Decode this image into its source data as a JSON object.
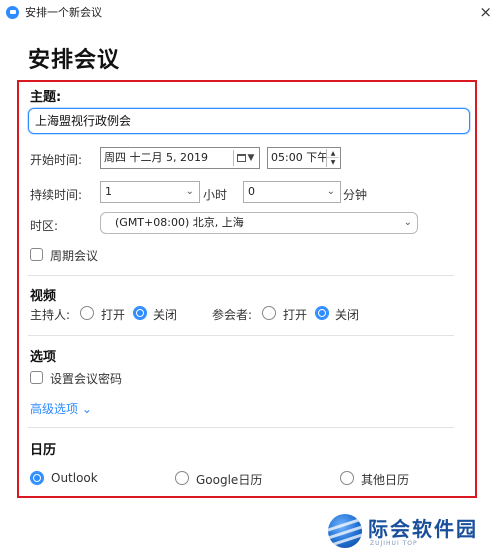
{
  "window": {
    "title": "安排一个新会议",
    "close_glyph": "×"
  },
  "page_title": "安排会议",
  "topic": {
    "label": "主题:",
    "value": "上海盟视行政例会"
  },
  "start_time": {
    "label": "开始时间:",
    "date_value": "周四  十二月   5, 2019",
    "time_value": "05:00 下午"
  },
  "duration": {
    "label": "持续时间:",
    "hours_value": "1",
    "hours_unit": "小时",
    "minutes_value": "0",
    "minutes_unit": "分钟"
  },
  "timezone": {
    "label": "时区:",
    "value": "(GMT+08:00) 北京, 上海"
  },
  "recurring": {
    "label": "周期会议",
    "checked": false
  },
  "video": {
    "heading": "视频",
    "host_label": "主持人:",
    "participant_label": "参会者:",
    "on_label": "打开",
    "off_label": "关闭",
    "host_selected": "关闭",
    "participant_selected": "关闭"
  },
  "options": {
    "heading": "选项",
    "password_label": "设置会议密码",
    "password_checked": false,
    "advanced_link": "高级选项",
    "chevron": "⌄"
  },
  "calendar": {
    "heading": "日历",
    "choices": [
      "Outlook",
      "Google日历",
      "其他日历"
    ],
    "selected": "Outlook"
  },
  "watermark": {
    "text": "际会软件园",
    "sub": "ZUJIHUI TOP"
  },
  "colors": {
    "accent": "#2d8cff",
    "highlight_frame": "#d9181f"
  }
}
